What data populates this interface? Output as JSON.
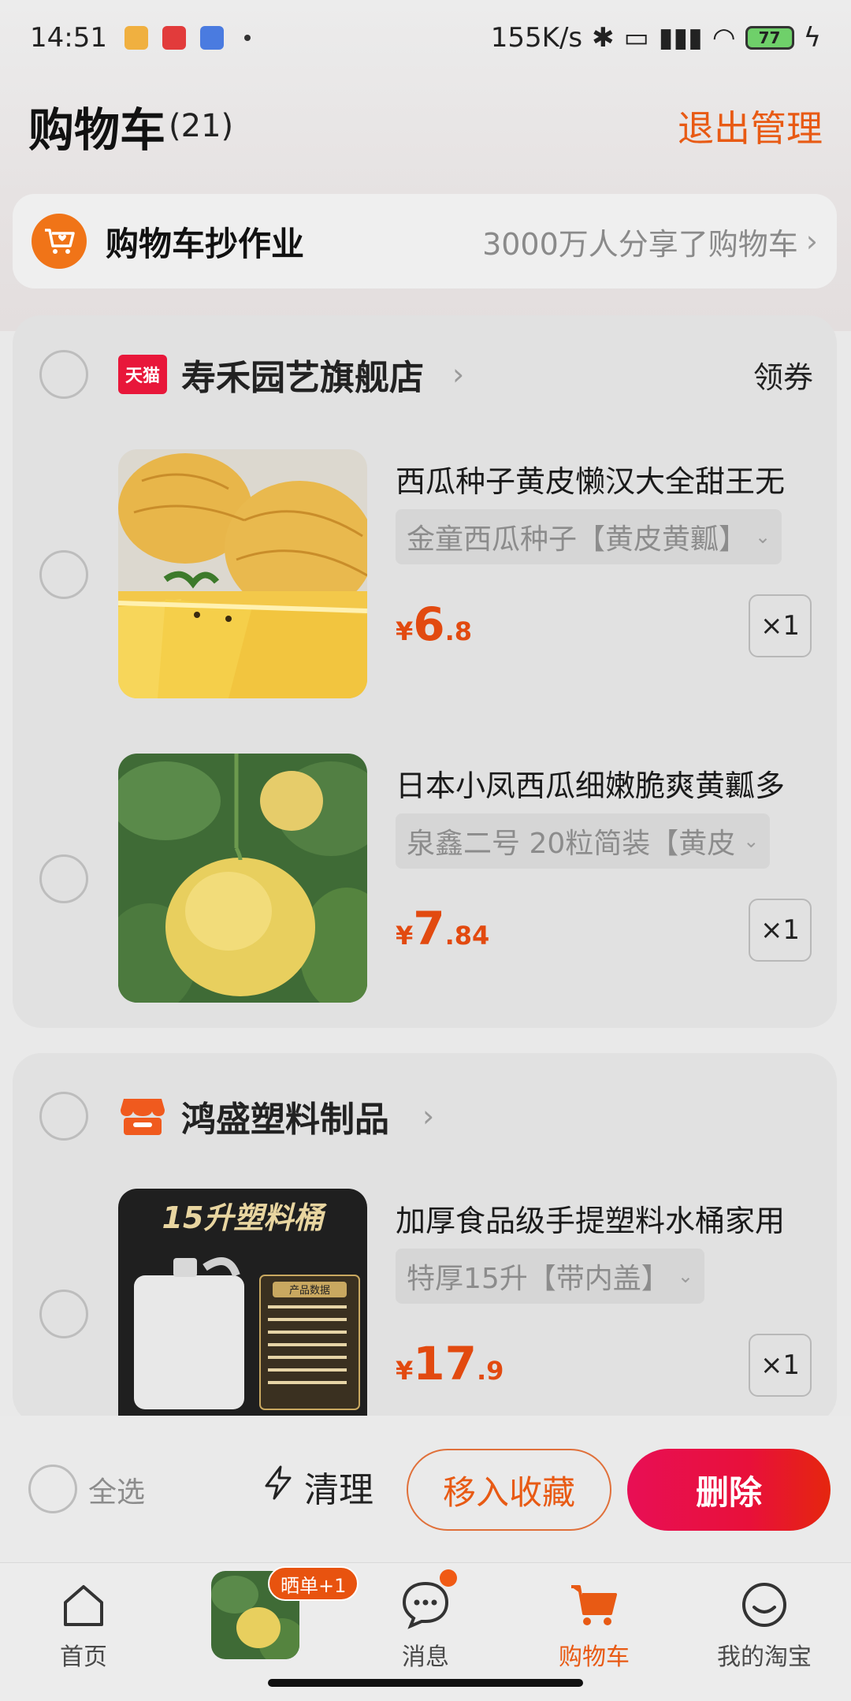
{
  "status_bar": {
    "time": "14:51",
    "network_speed": "155K/s",
    "battery": "77"
  },
  "header": {
    "title": "购物车",
    "count": "(21)",
    "exit_manage": "退出管理"
  },
  "homework": {
    "title": "购物车抄作业",
    "subtitle": "3000万人分享了购物车"
  },
  "stores": [
    {
      "badge": "天猫",
      "name": "寿禾园艺旗舰店",
      "coupon": "领券",
      "items": [
        {
          "name": "西瓜种子黄皮懒汉大全甜王无",
          "sku": "金童西瓜种子【黄皮黄瓤】",
          "price_symbol": "¥",
          "price_int": "6",
          "price_dec": ".8",
          "qty": "×1"
        },
        {
          "name": "日本小凤西瓜细嫩脆爽黄瓤多",
          "sku": "泉鑫二号 20粒简装【黄皮",
          "price_symbol": "¥",
          "price_int": "7",
          "price_dec": ".84",
          "qty": "×1"
        }
      ]
    },
    {
      "name": "鸿盛塑料制品",
      "items": [
        {
          "name": "加厚食品级手提塑料水桶家用",
          "sku": "特厚15升【带内盖】",
          "price_symbol": "¥",
          "price_int": "17",
          "price_dec": ".9",
          "qty": "×1",
          "image_text": "15升塑料桶",
          "image_table_title": "产品数据"
        }
      ]
    }
  ],
  "action_bar": {
    "select_all": "全选",
    "clean": "清理",
    "move_to_favorites": "移入收藏",
    "delete": "删除"
  },
  "tab_bar": {
    "home": "首页",
    "share_badge": "晒单+1",
    "messages": "消息",
    "cart": "购物车",
    "my_taobao": "我的淘宝"
  },
  "colors": {
    "accent": "#e85a14",
    "delete_gradient": "#e80f55",
    "tmall_red": "#e8173a"
  }
}
